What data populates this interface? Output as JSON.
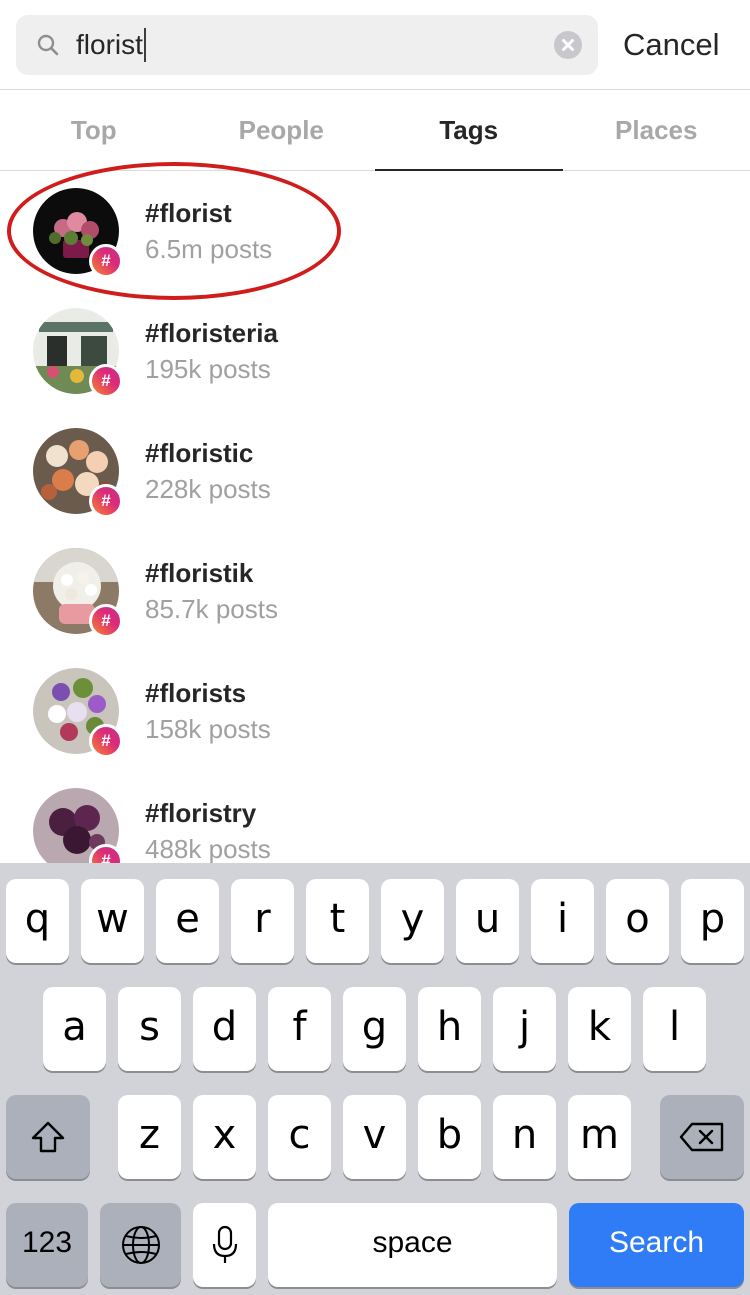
{
  "search": {
    "query": "florist",
    "cancel_label": "Cancel"
  },
  "tabs": [
    {
      "label": "Top",
      "active": false
    },
    {
      "label": "People",
      "active": false
    },
    {
      "label": "Tags",
      "active": true
    },
    {
      "label": "Places",
      "active": false
    }
  ],
  "results": [
    {
      "tag": "#florist",
      "count": "6.5m posts",
      "highlighted": true
    },
    {
      "tag": "#floristeria",
      "count": "195k posts"
    },
    {
      "tag": "#floristic",
      "count": "228k posts"
    },
    {
      "tag": "#floristik",
      "count": "85.7k posts"
    },
    {
      "tag": "#florists",
      "count": "158k posts"
    },
    {
      "tag": "#floristry",
      "count": "488k posts"
    }
  ],
  "badge_symbol": "#",
  "keyboard": {
    "row1": [
      "q",
      "w",
      "e",
      "r",
      "t",
      "y",
      "u",
      "i",
      "o",
      "p"
    ],
    "row2": [
      "a",
      "s",
      "d",
      "f",
      "g",
      "h",
      "j",
      "k",
      "l"
    ],
    "row3": [
      "z",
      "x",
      "c",
      "v",
      "b",
      "n",
      "m"
    ],
    "numbers_label": "123",
    "space_label": "space",
    "search_label": "Search"
  },
  "colors": {
    "highlight": "#d11c1c",
    "search_key": "#2f7cf6",
    "badge_gradient": [
      "#f58529",
      "#dd2a7b",
      "#c13584"
    ]
  },
  "icons": [
    "search-icon",
    "clear-icon",
    "hashtag-icon",
    "shift-icon",
    "delete-icon",
    "globe-icon",
    "microphone-icon"
  ]
}
